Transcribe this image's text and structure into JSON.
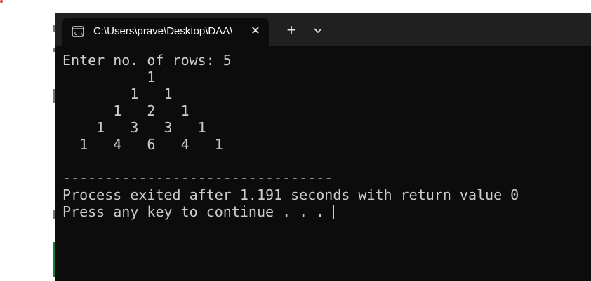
{
  "window": {
    "tab_title": "C:\\Users\\prave\\Desktop\\DAA\\",
    "tab_icon": "terminal-icon",
    "close_glyph": "✕",
    "new_tab_glyph": "+",
    "dropdown_icon": "chevron-down-icon"
  },
  "terminal": {
    "lines": [
      "Enter no. of rows: 5",
      "          1",
      "        1   1",
      "      1   2   1",
      "    1   3   3   1",
      "  1   4   6   4   1",
      "",
      "--------------------------------",
      "Process exited after 1.191 seconds with return value 0",
      "Press any key to continue . . . "
    ]
  },
  "colors": {
    "terminal_bg": "#0c0c0c",
    "tabbar_bg": "#202020",
    "text": "#cccccc"
  }
}
